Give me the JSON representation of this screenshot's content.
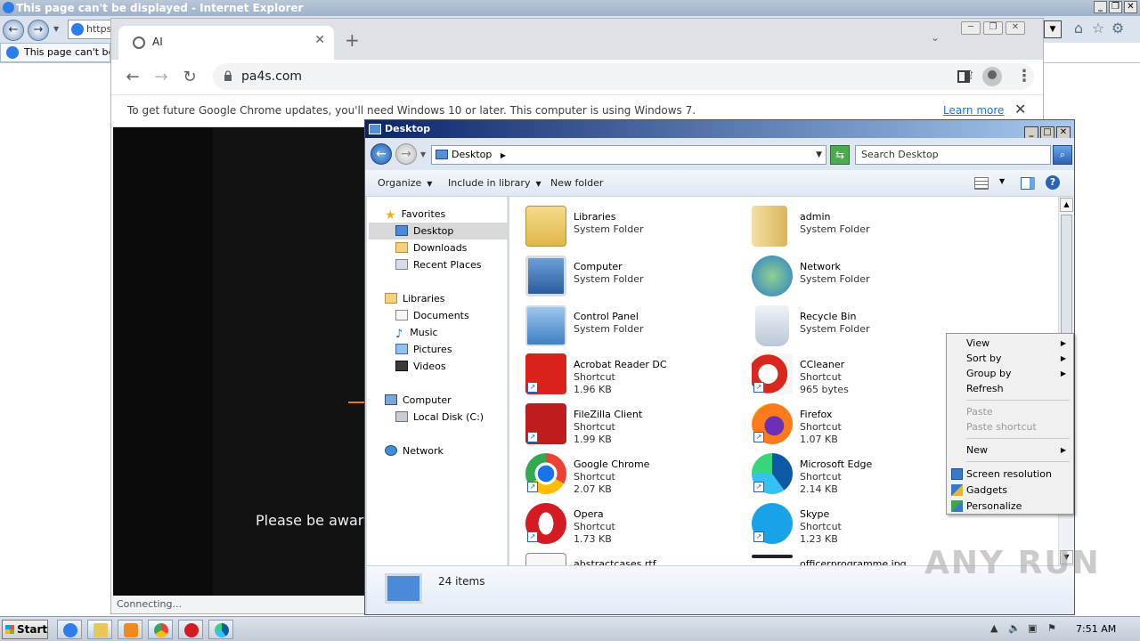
{
  "ie": {
    "title": "This page can't be displayed - Internet Explorer",
    "address": "https:",
    "tab_label": "This page can't be displayed"
  },
  "chrome": {
    "tab_title": "AI",
    "url": "pa4s.com",
    "infobar_message": "To get future Google Chrome updates, you'll need Windows 10 or later. This computer is using Windows 7.",
    "infobar_link": "Learn more",
    "page_text": "Please be aware",
    "status": "Connecting..."
  },
  "explorer": {
    "title": "Desktop",
    "address": "Desktop",
    "search_placeholder": "Search Desktop",
    "commands": {
      "organize": "Organize",
      "include": "Include in library",
      "new_folder": "New folder"
    },
    "nav": {
      "favorites": "Favorites",
      "desktop": "Desktop",
      "downloads": "Downloads",
      "recent": "Recent Places",
      "libraries": "Libraries",
      "documents": "Documents",
      "music": "Music",
      "pictures": "Pictures",
      "videos": "Videos",
      "computer": "Computer",
      "local_disk": "Local Disk (C:)",
      "network": "Network"
    },
    "files": [
      {
        "name": "Libraries",
        "type": "System Folder",
        "size": ""
      },
      {
        "name": "admin",
        "type": "System Folder",
        "size": ""
      },
      {
        "name": "Computer",
        "type": "System Folder",
        "size": ""
      },
      {
        "name": "Network",
        "type": "System Folder",
        "size": ""
      },
      {
        "name": "Control Panel",
        "type": "System Folder",
        "size": ""
      },
      {
        "name": "Recycle Bin",
        "type": "System Folder",
        "size": ""
      },
      {
        "name": "Acrobat Reader DC",
        "type": "Shortcut",
        "size": "1.96 KB"
      },
      {
        "name": "CCleaner",
        "type": "Shortcut",
        "size": "965 bytes"
      },
      {
        "name": "FileZilla Client",
        "type": "Shortcut",
        "size": "1.99 KB"
      },
      {
        "name": "Firefox",
        "type": "Shortcut",
        "size": "1.07 KB"
      },
      {
        "name": "Google Chrome",
        "type": "Shortcut",
        "size": "2.07 KB"
      },
      {
        "name": "Microsoft Edge",
        "type": "Shortcut",
        "size": "2.14 KB"
      },
      {
        "name": "Opera",
        "type": "Shortcut",
        "size": "1.73 KB"
      },
      {
        "name": "Skype",
        "type": "Shortcut",
        "size": "1.23 KB"
      },
      {
        "name": "abstractcases.rtf",
        "type": "",
        "size": ""
      },
      {
        "name": "officerprogramme.jpg",
        "type": "",
        "size": ""
      }
    ],
    "item_count": "24 items"
  },
  "context_menu": {
    "view": "View",
    "sort_by": "Sort by",
    "group_by": "Group by",
    "refresh": "Refresh",
    "paste": "Paste",
    "paste_shortcut": "Paste shortcut",
    "new": "New",
    "screen_resolution": "Screen resolution",
    "gadgets": "Gadgets",
    "personalize": "Personalize"
  },
  "taskbar": {
    "start": "Start",
    "clock": "7:51 AM"
  },
  "watermark": "ANY RUN"
}
